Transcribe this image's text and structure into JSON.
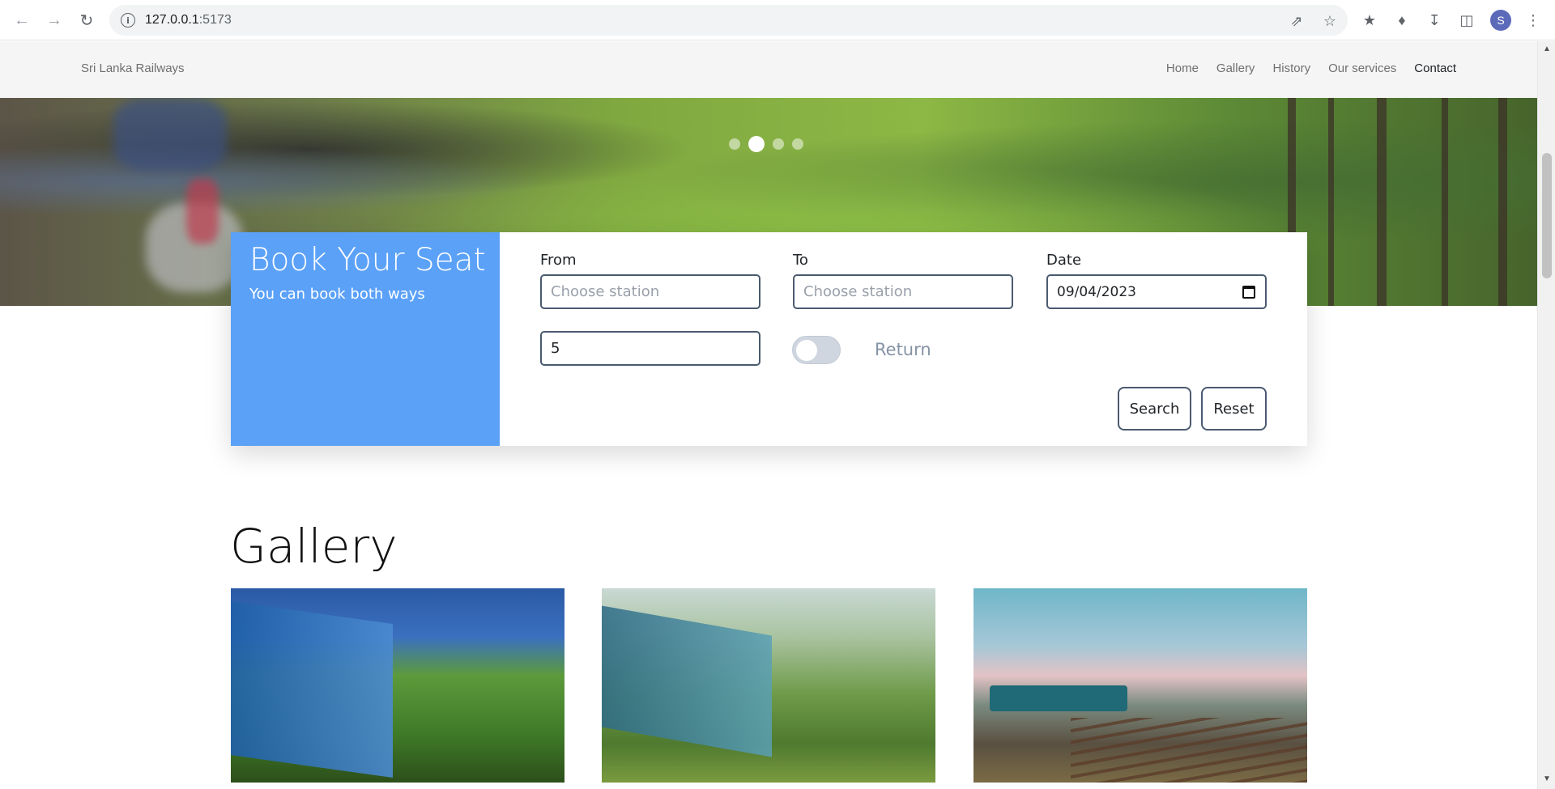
{
  "browser": {
    "url_host": "127.0.0.1",
    "url_port": ":5173",
    "avatar_letter": "S"
  },
  "nav": {
    "brand": "Sri Lanka Railways",
    "links": [
      "Home",
      "Gallery",
      "History",
      "Our services",
      "Contact"
    ],
    "active_link": "Contact"
  },
  "carousel": {
    "slide_count": 4,
    "active_index": 1
  },
  "booking": {
    "title": "Book Your Seat",
    "subtitle": "You can book both ways",
    "from_label": "From",
    "from_placeholder": "Choose station",
    "to_label": "To",
    "to_placeholder": "Choose station",
    "date_label": "Date",
    "date_value": "09/04/2023",
    "passengers_value": "5",
    "return_label": "Return",
    "return_enabled": false,
    "search_label": "Search",
    "reset_label": "Reset",
    "panel_color": "#5ba1f7"
  },
  "gallery": {
    "title": "Gallery"
  }
}
